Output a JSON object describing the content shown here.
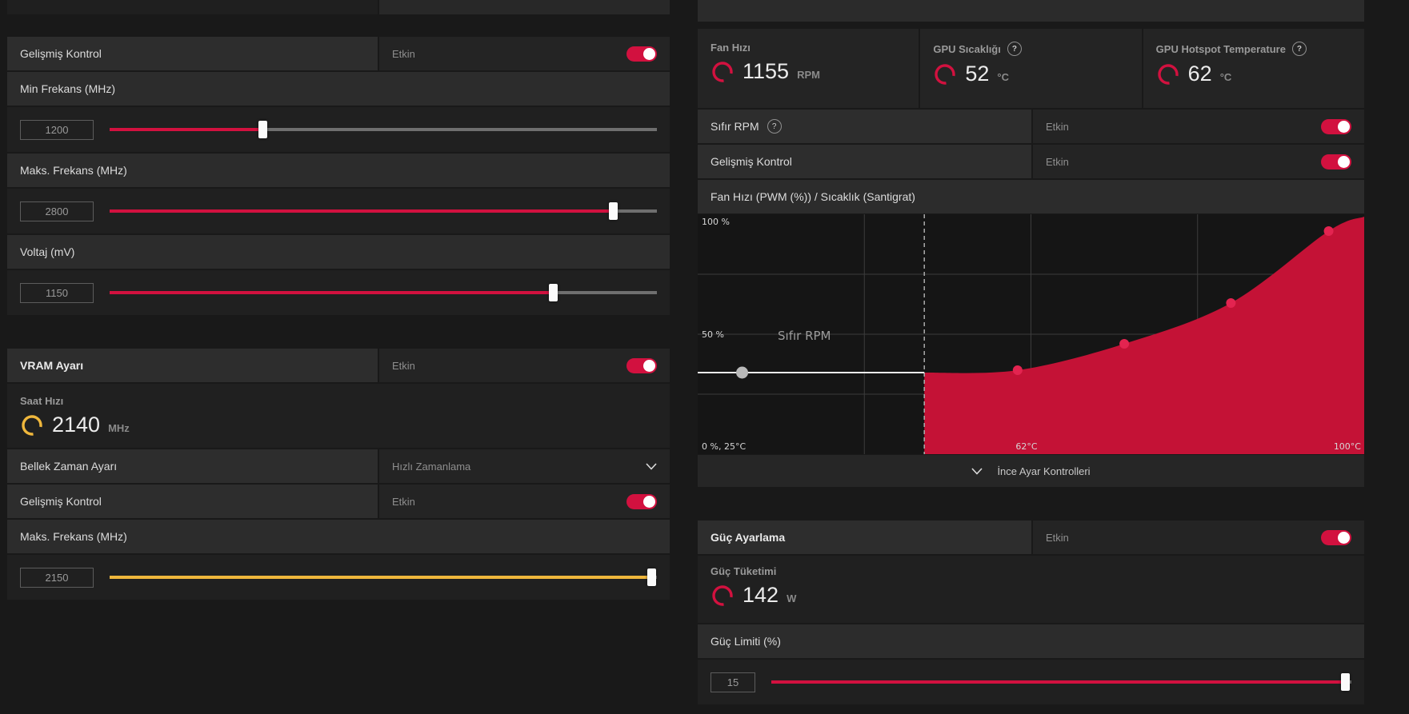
{
  "colors": {
    "red": "#d2113f",
    "yellow": "#efb73c",
    "area": "#c41236",
    "dot": "#e32450"
  },
  "left": {
    "tuning": {
      "advanced": {
        "label": "Gelişmiş Kontrol",
        "state": "Etkin"
      },
      "min_freq": {
        "label": "Min Frekans (MHz)",
        "value": "1200",
        "percent": 28,
        "color": "red"
      },
      "max_freq": {
        "label": "Maks. Frekans (MHz)",
        "value": "2800",
        "percent": 92,
        "color": "red"
      },
      "voltage": {
        "label": "Voltaj (mV)",
        "value": "1150",
        "percent": 81,
        "color": "red"
      }
    },
    "vram": {
      "title": "VRAM Ayarı",
      "state": "Etkin",
      "clock": {
        "label": "Saat Hızı",
        "value": "2140",
        "unit": "MHz"
      },
      "timing": {
        "label": "Bellek Zaman Ayarı",
        "value": "Hızlı Zamanlama"
      },
      "advanced": {
        "label": "Gelişmiş Kontrol",
        "state": "Etkin"
      },
      "max_freq": {
        "label": "Maks. Frekans (MHz)",
        "value": "2150",
        "percent": 99,
        "color": "yellow"
      }
    }
  },
  "right": {
    "fan": {
      "stats": [
        {
          "label": "Fan Hızı",
          "value": "1155",
          "unit": "RPM"
        },
        {
          "label": "GPU Sıcaklığı",
          "value": "52",
          "unit": "°C"
        },
        {
          "label": "GPU Hotspot Temperature",
          "value": "62",
          "unit": "°C"
        }
      ],
      "zero_rpm": {
        "label": "Sıfır RPM",
        "state": "Etkin"
      },
      "advanced": {
        "label": "Gelişmiş Kontrol",
        "state": "Etkin"
      },
      "chart_title": "Fan Hızı (PWM (%)) / Sıcaklık (Santigrat)",
      "expander_label": "İnce Ayar Kontrolleri"
    },
    "power": {
      "title": "Güç Ayarlama",
      "state": "Etkin",
      "consumption": {
        "label": "Güç Tüketimi",
        "value": "142",
        "unit": "W"
      },
      "limit": {
        "label": "Güç Limiti (%)",
        "value": "15",
        "percent": 99,
        "color": "red"
      }
    }
  },
  "chart_data": {
    "type": "area",
    "title": "Fan Hızı (PWM (%)) / Sıcaklık (Santigrat)",
    "x_label": "Sıcaklık (Santigrat)",
    "y_label": "Fan Hızı (PWM %)",
    "x_range": [
      25,
      100
    ],
    "y_range": [
      0,
      100
    ],
    "y_tick_top": "100 %",
    "y_tick_mid": "50 %",
    "origin_label": "0 %, 25°C",
    "x_ticks": [
      {
        "temp": 62,
        "label": "62°C"
      },
      {
        "temp": 100,
        "label": "100°C"
      }
    ],
    "current_temp": 50.5,
    "zero_rpm": {
      "pwm": 34,
      "end_temp": 50.5,
      "handle_temp": 30,
      "label": "Sıfır RPM"
    },
    "curve": [
      [
        50.5,
        34
      ],
      [
        61,
        35
      ],
      [
        73,
        46
      ],
      [
        85,
        63
      ],
      [
        96,
        93
      ],
      [
        100,
        99
      ]
    ],
    "handles": [
      [
        61,
        35
      ],
      [
        73,
        46
      ],
      [
        85,
        63
      ],
      [
        96,
        93
      ]
    ],
    "grid_fractions": [
      0.25,
      0.5,
      0.75
    ],
    "legend": "off",
    "grid": "on"
  }
}
